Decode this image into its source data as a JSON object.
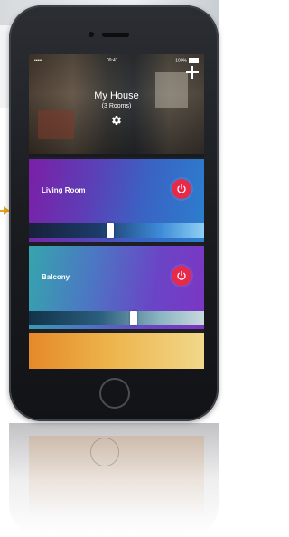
{
  "status_bar": {
    "carrier": "•••••  ",
    "time": "09:41",
    "battery": "100%"
  },
  "header": {
    "title": "My House",
    "subtitle": "(3 Rooms)"
  },
  "rooms": [
    {
      "label": "Living Room",
      "power": "on",
      "slider_level": 0.46
    },
    {
      "label": "Balcony",
      "power": "on",
      "slider_level": 0.6
    }
  ],
  "icons": {
    "add": "plus-icon",
    "settings": "gear-icon",
    "power": "power-icon",
    "pointer": "arrow-icon"
  },
  "colors": {
    "power_button": "#e8294a",
    "accent_arrow": "#e6a21b",
    "living_room_gradient_start": "#7b1fa7",
    "living_room_gradient_end": "#2b7fce",
    "balcony_gradient_start": "#35a5ad",
    "balcony_gradient_end": "#7c35c2",
    "third_room_gradient_start": "#e5892a",
    "third_room_gradient_end": "#f1d88a"
  }
}
